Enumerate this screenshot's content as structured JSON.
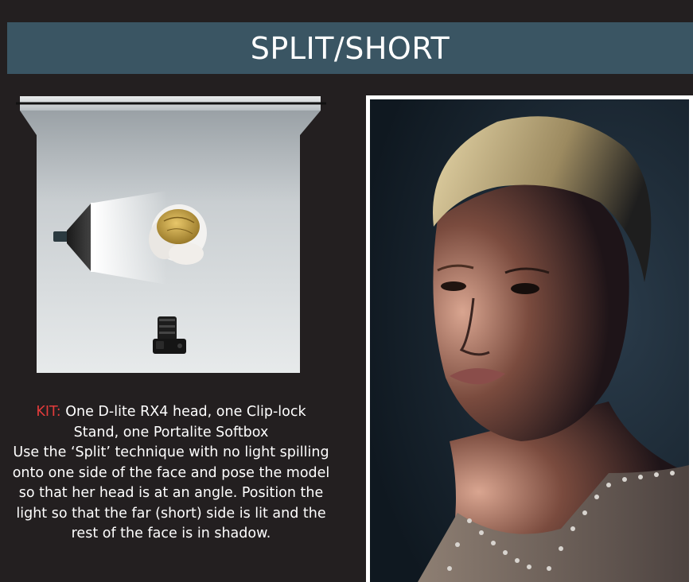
{
  "header": {
    "title": "SPLIT/SHORT"
  },
  "kit": {
    "label": "KIT:",
    "line1": " One D-lite RX4 head, one Clip-lock",
    "line2": "Stand, one Portalite Softbox",
    "line3": "Use the ‘Split’ technique with no light spilling",
    "line4": "onto one side of the face and pose the model",
    "line5": "so that her head is at an angle. Position the",
    "line6": "light so that the far (short) side is lit and the",
    "line7": "rest of the face is in shadow."
  },
  "colors": {
    "background": "#231f20",
    "title_bar": "#3a5563",
    "kit_label": "#e23b3b",
    "text": "#ffffff"
  },
  "icons": {
    "softbox": "softbox-light-icon",
    "camera": "camera-icon",
    "model": "model-head-icon"
  }
}
